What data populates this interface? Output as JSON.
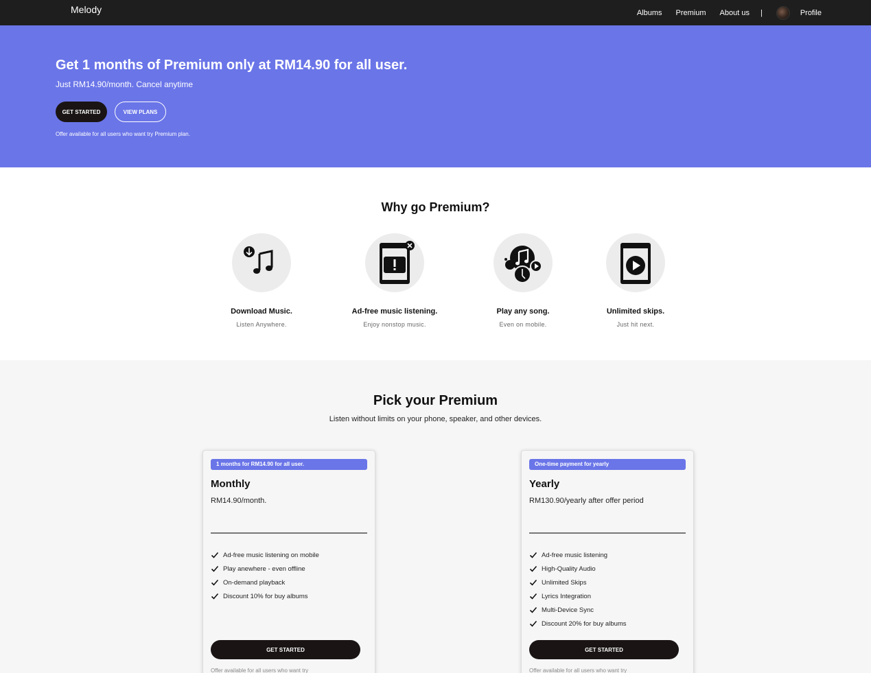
{
  "nav": {
    "brand": "Melody",
    "links": [
      "Albums",
      "Premium",
      "About us"
    ],
    "separator": "|",
    "profile": "Profile"
  },
  "hero": {
    "title": "Get 1 months of Premium only at RM14.90 for all user.",
    "subtitle": "Just RM14.90/month. Cancel anytime",
    "primary_button": "GET STARTED",
    "secondary_button": "VIEW PLANS",
    "note": "Offer available for all users who want try Premium plan.",
    "color": "#6a75e8"
  },
  "why": {
    "title": "Why go Premium?",
    "features": [
      {
        "title": "Download Music.",
        "subtitle": "Listen Anywhere.",
        "icon": "download-music-icon"
      },
      {
        "title": "Ad-free music listening.",
        "subtitle": "Enjoy nonstop music.",
        "icon": "ad-free-phone-icon"
      },
      {
        "title": "Play any song.",
        "subtitle": "Even on mobile.",
        "icon": "play-any-song-icon"
      },
      {
        "title": "Unlimited skips.",
        "subtitle": "Just hit next.",
        "icon": "phone-play-icon"
      }
    ]
  },
  "pick": {
    "title": "Pick your Premium",
    "subtitle": "Listen without limits on your phone, speaker, and other devices.",
    "plans": [
      {
        "tag": "1 months for RM14.90 for all user.",
        "name": "Monthly",
        "price": "RM14.90/month.",
        "features": [
          "Ad-free music listening on mobile",
          "Play anewhere - even offline",
          "On-demand playback",
          "Discount 10% for buy albums"
        ],
        "button": "GET STARTED",
        "note": "Offer available for all users who want try"
      },
      {
        "tag": "One-time payment for yearly",
        "name": "Yearly",
        "price": "RM130.90/yearly after offer period",
        "features": [
          "Ad-free music listening",
          "High-Quality Audio",
          "Unlimited Skips",
          "Lyrics Integration",
          "Multi-Device Sync",
          "Discount 20% for buy albums"
        ],
        "button": "GET STARTED",
        "note": "Offer available for all users who want try"
      }
    ]
  }
}
